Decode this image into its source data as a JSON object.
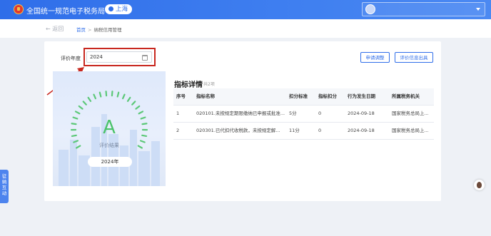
{
  "header": {
    "app_title": "全国统一规范电子税务局",
    "region": "上海",
    "user_name": ""
  },
  "breadcrumb": {
    "back": "← 返回",
    "home": "首页",
    "separator": ">",
    "current": "纳税信用管理"
  },
  "filter": {
    "year_label": "评价年度",
    "year_value": "2024"
  },
  "actions": {
    "apply_adjust": "申请调整",
    "issue_report": "评价信息出具"
  },
  "rating": {
    "grade": "A",
    "caption": "评价结果",
    "year": "2024年"
  },
  "details": {
    "title": "指标详情",
    "count": "共2项",
    "columns": [
      "序号",
      "指标名称",
      "扣分标准",
      "指标扣分",
      "行为发生日期",
      "所属税务机关"
    ],
    "rows": [
      [
        "1",
        "020101.未按规定期限缴纳已申报或批准...",
        "5分",
        "0",
        "2024-09-18",
        "国家税务总局上..."
      ],
      [
        "2",
        "020301.已代扣代收税款，未按规定解...",
        "11分",
        "0",
        "2024-09-18",
        "国家税务总局上..."
      ]
    ]
  },
  "side_tab": [
    "征",
    "纳",
    "互",
    "动"
  ],
  "colors": {
    "brand_blue": "#2f6ee9",
    "grade_green": "#4bc36a",
    "highlight_red": "#c8271f"
  }
}
